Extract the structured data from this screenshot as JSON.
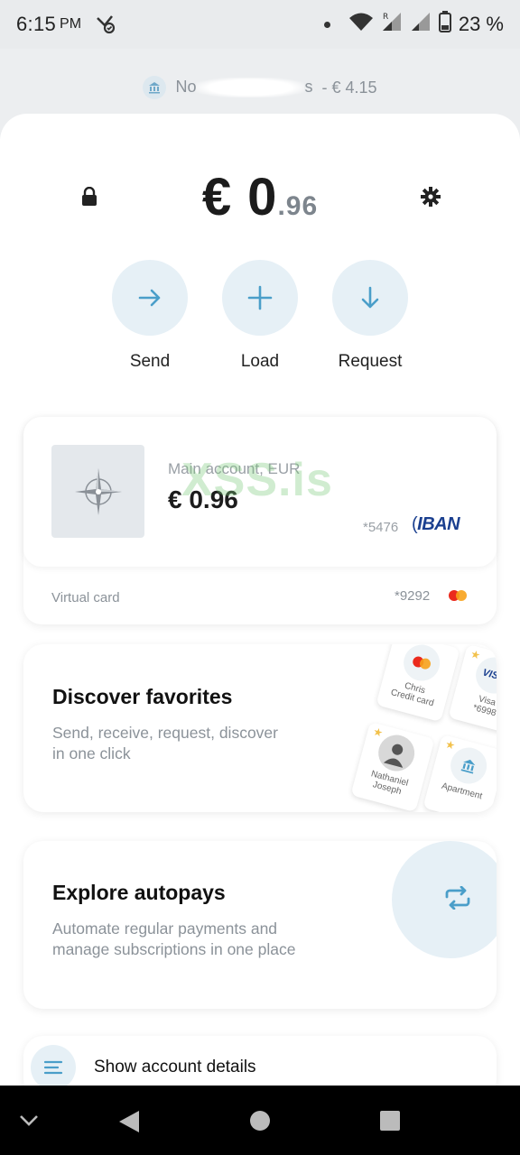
{
  "status_bar": {
    "time": "6:15",
    "ampm": "PM",
    "battery": "23 %"
  },
  "account_chip": {
    "name_visible_start": "No",
    "name_visible_end": "s",
    "balance": "- € 4.15"
  },
  "balance": {
    "whole": "€ 0",
    "cents": ".96"
  },
  "actions": [
    {
      "label": "Send"
    },
    {
      "label": "Load"
    },
    {
      "label": "Request"
    }
  ],
  "main_account": {
    "name": "Main account, EUR",
    "balance": "€ 0.96",
    "number": "*5476",
    "iban_label": "IBAN",
    "watermark": "XSS.is"
  },
  "virtual_card": {
    "label": "Virtual card",
    "number": "*9292"
  },
  "favorites": {
    "title": "Discover favorites",
    "description": "Send, receive, request, discover in one click",
    "tiles": [
      {
        "line1": "Chris",
        "line2": "Credit card"
      },
      {
        "line1": "Visa",
        "line2": "*6998",
        "badge": "VISA"
      },
      {
        "line1": "Nathaniel",
        "line2": "Joseph"
      },
      {
        "line1": "Apartment",
        "line2": ""
      }
    ]
  },
  "autopays": {
    "title": "Explore autopays",
    "description": "Automate regular payments and manage subscriptions in one place"
  },
  "account_details": {
    "label": "Show account details"
  },
  "colors": {
    "accent": "#4a9ec9",
    "bubble": "#e6f0f6",
    "muted_text": "#8b9299"
  }
}
